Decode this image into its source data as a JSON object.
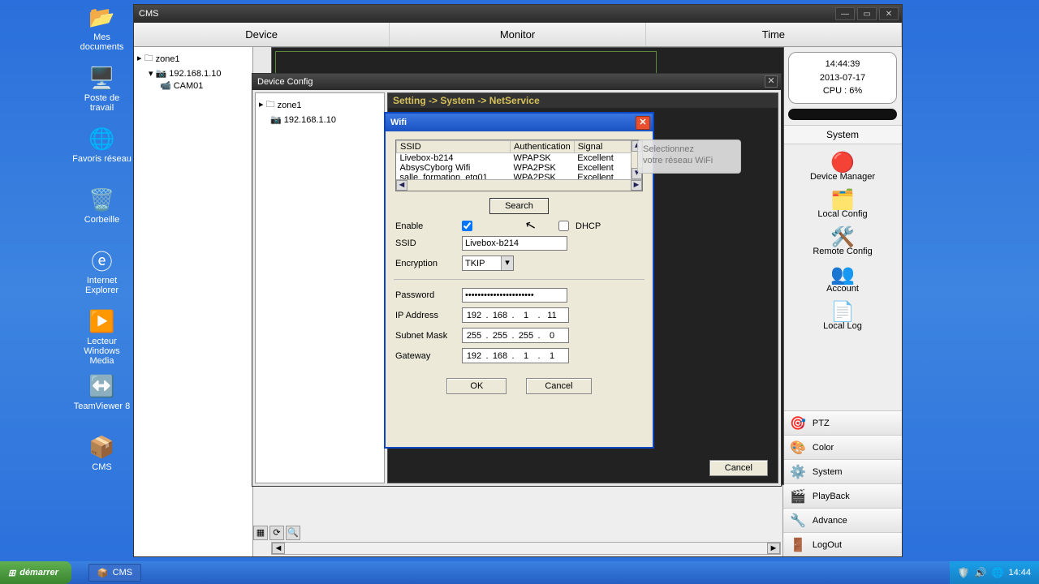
{
  "desktop_icons": [
    {
      "label": "Mes documents",
      "glyph": "📂"
    },
    {
      "label": "Poste de travail",
      "glyph": "🖥️"
    },
    {
      "label": "Favoris réseau",
      "glyph": "🌐"
    },
    {
      "label": "Corbeille",
      "glyph": "🗑️"
    },
    {
      "label": "Internet Explorer",
      "glyph": "ⓔ"
    },
    {
      "label": "Lecteur Windows Media",
      "glyph": "▶️"
    },
    {
      "label": "TeamViewer 8",
      "glyph": "↔️"
    },
    {
      "label": "CMS",
      "glyph": "📦"
    }
  ],
  "cms": {
    "title": "CMS",
    "menu": {
      "device": "Device",
      "monitor": "Monitor",
      "time": "Time"
    },
    "tree": {
      "zone": "zone1",
      "ip": "192.168.1.10",
      "cam": "CAM01"
    },
    "clock": {
      "time": "14:44:39",
      "date": "2013-07-17",
      "cpu": "CPU : 6%"
    },
    "system_header": "System",
    "system_items": [
      {
        "label": "Device Manager",
        "glyph": "🔴"
      },
      {
        "label": "Local Config",
        "glyph": "🗂️"
      },
      {
        "label": "Remote Config",
        "glyph": "🛠️"
      },
      {
        "label": "Account",
        "glyph": "👥"
      },
      {
        "label": "Local Log",
        "glyph": "📄"
      }
    ],
    "side_tabs": [
      {
        "label": "PTZ",
        "glyph": "🎯"
      },
      {
        "label": "Color",
        "glyph": "🎨"
      },
      {
        "label": "System",
        "glyph": "⚙️"
      },
      {
        "label": "PlayBack",
        "glyph": "🎬"
      },
      {
        "label": "Advance",
        "glyph": "🔧"
      },
      {
        "label": "LogOut",
        "glyph": "🚪"
      }
    ]
  },
  "devcfg": {
    "title": "Device Config",
    "tree": {
      "zone": "zone1",
      "ip": "192.168.1.10"
    },
    "breadcrumb": "Setting -> System -> NetService",
    "cancel": "Cancel"
  },
  "wifi": {
    "title": "Wifi",
    "headers": {
      "ssid": "SSID",
      "auth": "Authentication",
      "signal": "Signal"
    },
    "networks": [
      {
        "ssid": "Livebox-b214",
        "auth": "WPAPSK",
        "signal": "Excellent"
      },
      {
        "ssid": "AbsysCyborg Wifi",
        "auth": "WPA2PSK",
        "signal": "Excellent"
      },
      {
        "ssid": "salle_formation_etg01",
        "auth": "WPA2PSK",
        "signal": "Excellent"
      }
    ],
    "search": "Search",
    "labels": {
      "enable": "Enable",
      "dhcp": "DHCP",
      "ssid": "SSID",
      "encryption": "Encryption",
      "password": "Password",
      "ip": "IP Address",
      "subnet": "Subnet Mask",
      "gateway": "Gateway"
    },
    "values": {
      "ssid": "Livebox-b214",
      "encryption": "TKIP",
      "password": "••••••••••••••••••••••",
      "ip": [
        "192",
        "168",
        "1",
        "11"
      ],
      "subnet": [
        "255",
        "255",
        "255",
        "0"
      ],
      "gateway": [
        "192",
        "168",
        "1",
        "1"
      ]
    },
    "ok": "OK",
    "cancel": "Cancel"
  },
  "tooltip": {
    "line1": "Selectionnez",
    "line2": "votre réseau WiFi"
  },
  "taskbar": {
    "start": "démarrer",
    "task": "CMS",
    "time": "14:44"
  }
}
